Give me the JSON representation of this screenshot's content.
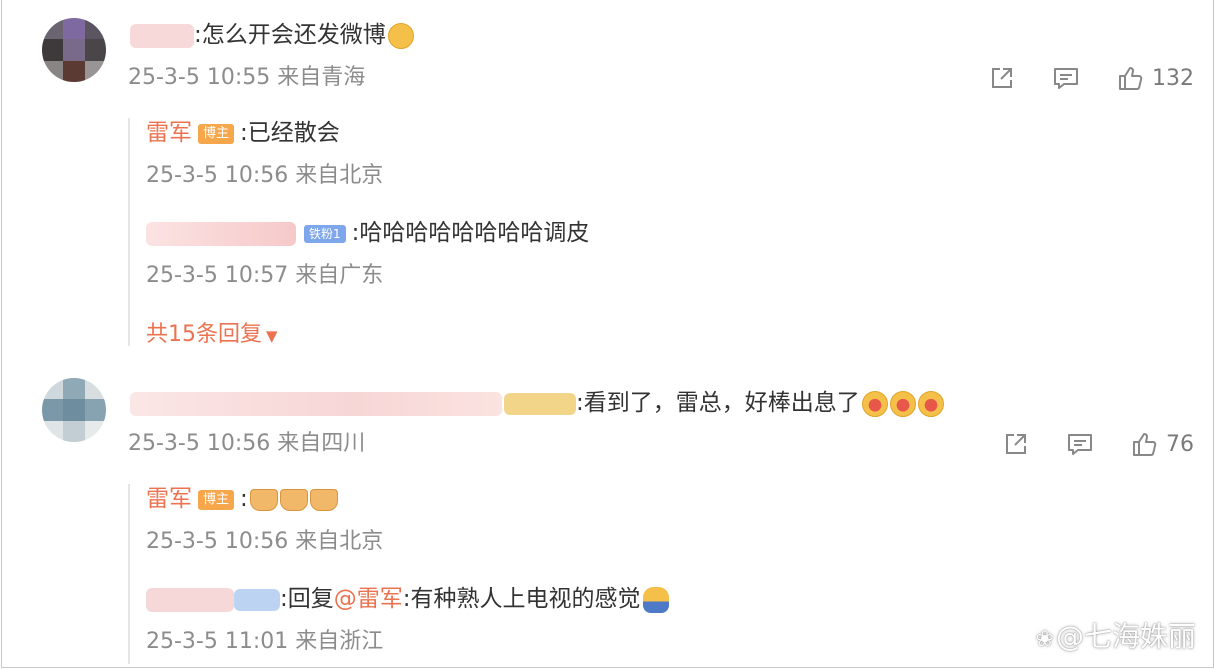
{
  "comments": [
    {
      "text": ":怎么开会还发微博",
      "meta": "25-3-5 10:55 来自青海",
      "likes": "132",
      "replies": [
        {
          "author": "雷军",
          "badge": "博主",
          "text": ":已经散会",
          "meta": "25-3-5 10:56 来自北京"
        },
        {
          "fan_badge": "铁粉1",
          "text": ":哈哈哈哈哈哈哈哈调皮",
          "meta": "25-3-5 10:57 来自广东"
        }
      ],
      "more_replies": "共15条回复"
    },
    {
      "text": ":看到了，雷总，好棒出息了",
      "meta": "25-3-5 10:56 来自四川",
      "likes": "76",
      "replies": [
        {
          "author": "雷军",
          "badge": "博主",
          "text": ":",
          "meta": "25-3-5 10:56 来自北京"
        },
        {
          "prefix": ":回复",
          "mention": "@雷军",
          "text": ":有种熟人上电视的感觉",
          "meta": "25-3-5 11:01 来自浙江"
        }
      ]
    }
  ],
  "icons": [
    "share-icon",
    "comment-icon",
    "like-icon"
  ],
  "colors": {
    "accent": "#eb7350",
    "meta": "#8c8c8c",
    "host_badge": "#f6a64b",
    "fan_badge": "#7ea6ea"
  },
  "watermark": "@七海姝丽"
}
